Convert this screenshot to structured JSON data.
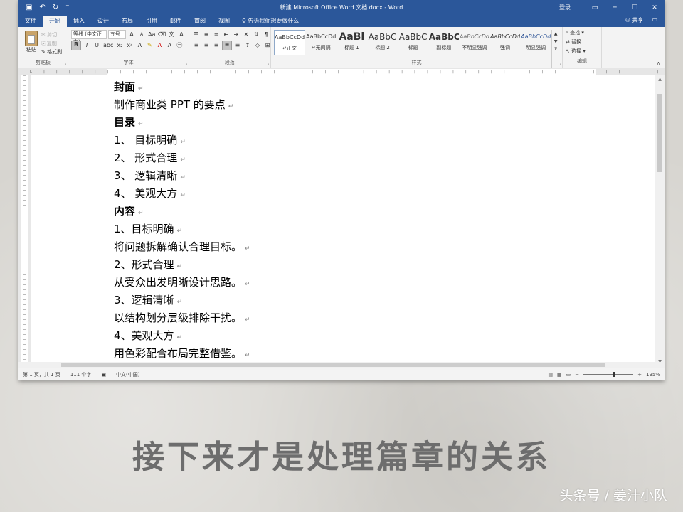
{
  "window": {
    "title": "新建 Microsoft Office Word 文档.docx  -  Word",
    "login": "登录",
    "share": "共享",
    "controls": [
      "▭",
      "─",
      "☐",
      "✕"
    ]
  },
  "tabs": [
    "文件",
    "开始",
    "插入",
    "设计",
    "布局",
    "引用",
    "邮件",
    "审阅",
    "视图"
  ],
  "tell_me": "告诉我你想要做什么",
  "ribbon": {
    "clipboard": {
      "label": "剪贴板",
      "paste": "粘贴",
      "cut": "剪切",
      "copy": "复制",
      "format_painter": "格式刷"
    },
    "font": {
      "label": "字体",
      "font_name": "等线 (中文正文)",
      "font_size": "五号"
    },
    "paragraph": {
      "label": "段落"
    },
    "styles": {
      "label": "样式",
      "items": [
        {
          "sample": "AaBbCcDd",
          "name": "↵正文"
        },
        {
          "sample": "AaBbCcDd",
          "name": "↵无间隔"
        },
        {
          "sample": "AaBl",
          "name": "标题 1"
        },
        {
          "sample": "AaBbC",
          "name": "标题 2"
        },
        {
          "sample": "AaBbC",
          "name": "标题"
        },
        {
          "sample": "AaBbC",
          "name": "副标题"
        },
        {
          "sample": "AaBbCcDd",
          "name": "不明显强调"
        },
        {
          "sample": "AaBbCcDd",
          "name": "强调"
        },
        {
          "sample": "AaBbCcDd",
          "name": "明显强调"
        }
      ]
    },
    "editing": {
      "label": "编辑",
      "find": "查找",
      "replace": "替换",
      "select": "选择"
    }
  },
  "document": {
    "lines": [
      {
        "text": "封面",
        "bold": true
      },
      {
        "text": "制作商业类 PPT 的要点",
        "bold": false
      },
      {
        "text": "目录",
        "bold": true
      },
      {
        "text": "1、 目标明确",
        "bold": false
      },
      {
        "text": "2、 形式合理",
        "bold": false
      },
      {
        "text": "3、 逻辑清晰",
        "bold": false
      },
      {
        "text": "4、 美观大方",
        "bold": false
      },
      {
        "text": "内容",
        "bold": true
      },
      {
        "text": "1、目标明确",
        "bold": false
      },
      {
        "text": "将问题拆解确认合理目标。",
        "bold": false
      },
      {
        "text": "2、形式合理",
        "bold": false
      },
      {
        "text": "从受众出发明晰设计思路。",
        "bold": false
      },
      {
        "text": "3、逻辑清晰",
        "bold": false
      },
      {
        "text": "以结构划分层级排除干扰。",
        "bold": false
      },
      {
        "text": "4、美观大方",
        "bold": false
      },
      {
        "text": "用色彩配合布局完整借鉴。",
        "bold": false
      }
    ]
  },
  "status": {
    "page": "第 1 页，共 1 页",
    "words": "111 个字",
    "language": "中文(中国)",
    "zoom": "195%"
  },
  "caption": "接下来才是处理篇章的关系",
  "watermark": "头条号 / 姜汁小队"
}
